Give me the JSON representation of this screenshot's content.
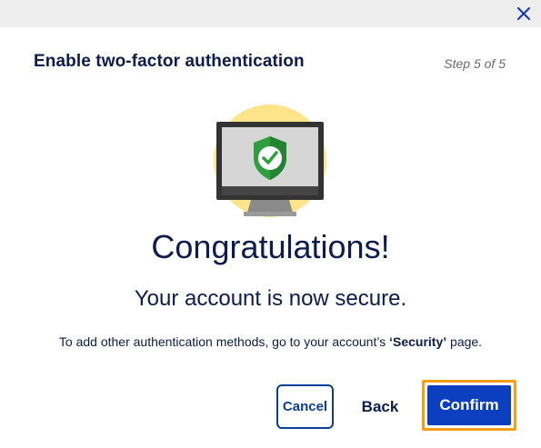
{
  "dialog": {
    "title": "Enable two-factor authentication",
    "step": "Step 5 of 5",
    "close_icon": "close-icon"
  },
  "illustration": {
    "icon": "secure-monitor-icon",
    "badge_icon": "shield-check-icon"
  },
  "content": {
    "headline": "Congratulations!",
    "subline": "Your account is now secure.",
    "info_prefix": "To add other authentication methods, go to your account’s ",
    "info_emphasis": "‘Security’",
    "info_suffix": " page."
  },
  "actions": {
    "cancel_label": "Cancel",
    "back_label": "Back",
    "confirm_label": "Confirm"
  },
  "colors": {
    "navy_text": "#0c1c4d",
    "primary_button": "#0b3fbf",
    "outline_blue": "#0a3e9c",
    "focus_ring": "#f59e14",
    "illustration_circle": "#fde48a",
    "shield_green": "#2e9e3f"
  }
}
